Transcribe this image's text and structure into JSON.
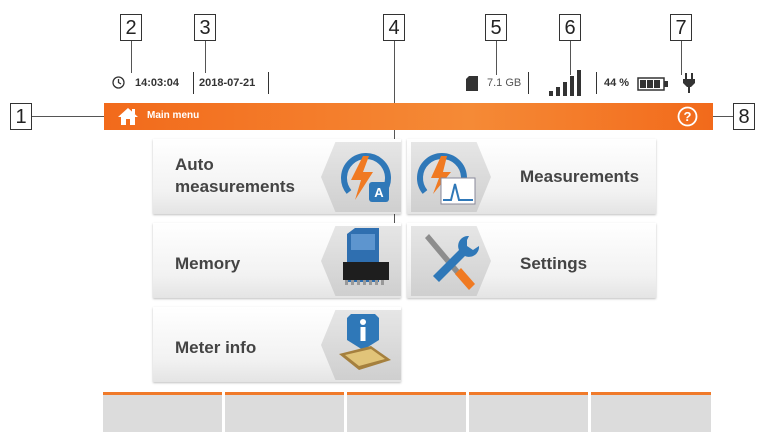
{
  "callouts": [
    "1",
    "2",
    "3",
    "4",
    "5",
    "6",
    "7",
    "8"
  ],
  "status": {
    "time": "14:03:04",
    "date": "2018-07-21",
    "storage": "7.1 GB",
    "battery": "44 %"
  },
  "header": {
    "title": "Main menu"
  },
  "menu": {
    "auto_line1": "Auto",
    "auto_line2": "measurements",
    "measurements": "Measurements",
    "memory": "Memory",
    "settings": "Settings",
    "meter_info": "Meter info"
  },
  "colors": {
    "accent": "#f26a1b",
    "bar_light": "#f58a36",
    "footer": "#dcdcdc"
  }
}
